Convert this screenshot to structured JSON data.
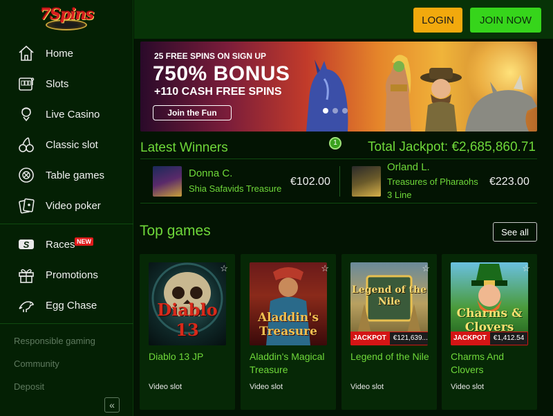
{
  "brand": {
    "logo_text": "7Spins"
  },
  "sidebar": {
    "items": [
      {
        "label": "Home",
        "icon": "home-icon"
      },
      {
        "label": "Slots",
        "icon": "slot-machine-icon"
      },
      {
        "label": "Live Casino",
        "icon": "dealer-icon"
      },
      {
        "label": "Classic slot",
        "icon": "cherries-icon"
      },
      {
        "label": "Table games",
        "icon": "roulette-icon"
      },
      {
        "label": "Video poker",
        "icon": "cards-icon"
      }
    ],
    "items2": [
      {
        "label": "Races",
        "icon": "races-icon",
        "badge": "NEW"
      },
      {
        "label": "Promotions",
        "icon": "gift-icon"
      },
      {
        "label": "Egg Chase",
        "icon": "dinosaur-icon"
      }
    ],
    "footer_links": [
      "Responsible gaming",
      "Community",
      "Deposit"
    ],
    "collapse_glyph": "«"
  },
  "header": {
    "login_label": "LOGIN",
    "join_label": "JOIN NOW"
  },
  "banner": {
    "line1": "25 FREE SPINS ON SIGN UP",
    "line2": "750% BONUS",
    "line3": "+110 CASH FREE SPINS",
    "cta": "Join the Fun",
    "active_slide": 1,
    "slide_count": 3
  },
  "winners": {
    "title": "Latest Winners",
    "badge": "1",
    "jackpot_label": "Total Jackpot:",
    "jackpot_value": "€2,685,860.71",
    "entries": [
      {
        "name": "Donna C.",
        "game": "Shia Safavids Treasure",
        "amount": "€102.00"
      },
      {
        "name": "Orland L.",
        "game": "Treasures of Pharaohs 3 Line",
        "amount": "€223.00"
      }
    ]
  },
  "top_games": {
    "title": "Top games",
    "see_all": "See all",
    "games": [
      {
        "name": "Diablo 13 JP",
        "type": "Video slot",
        "art_title": "Diablo 13"
      },
      {
        "name": "Aladdin's Magical Treasure",
        "type": "Video slot",
        "art_title": "Aladdin's Treasure"
      },
      {
        "name": "Legend of the Nile",
        "type": "Video slot",
        "art_title": "Legend of the Nile",
        "jackpot_label": "JACKPOT",
        "jackpot_value": "€121,639...."
      },
      {
        "name": "Charms And Clovers",
        "type": "Video slot",
        "art_title": "Charms & Clovers",
        "jackpot_label": "JACKPOT",
        "jackpot_value": "€1,412.54"
      }
    ]
  },
  "colors": {
    "accent_green": "#6fd83a",
    "login_yellow": "#f2a90d",
    "join_green": "#36d51b",
    "jackpot_red": "#d41515"
  }
}
